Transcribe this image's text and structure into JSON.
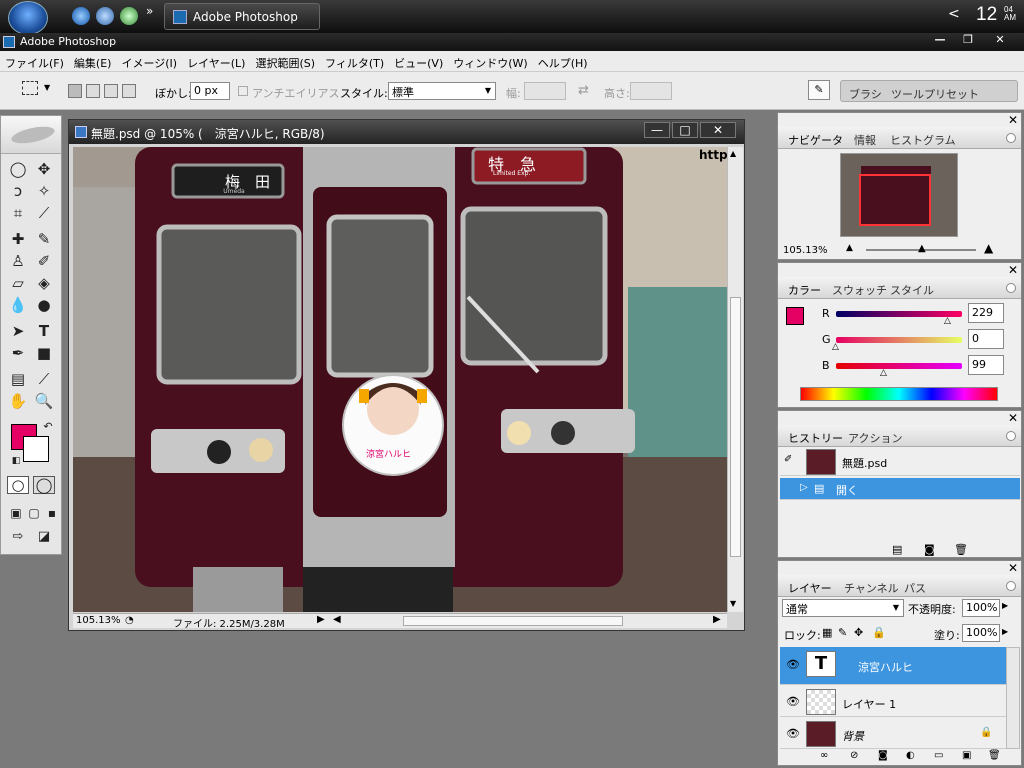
{
  "taskbar": {
    "app_button_label": "Adobe Photoshop",
    "clock_time": "12",
    "clock_min": "04",
    "clock_ampm": "AM",
    "tray_arrow": "<"
  },
  "app": {
    "title": "Adobe Photoshop"
  },
  "menu": [
    "ファイル(F)",
    "編集(E)",
    "イメージ(I)",
    "レイヤー(L)",
    "選択範囲(S)",
    "フィルタ(T)",
    "ビュー(V)",
    "ウィンドウ(W)",
    "ヘルプ(H)"
  ],
  "options": {
    "feather_label": "ぼかし:",
    "feather_value": "0 px",
    "antialias_label": "アンチエイリアス",
    "style_label": "スタイル:",
    "style_value": "標準",
    "width_label": "幅:",
    "height_label": "高さ:",
    "brush_tab": "ブラシ",
    "preset_tab": "ツールプリセット"
  },
  "document": {
    "title": "無題.psd @ 105% (　涼宮ハルヒ, RGB/8)",
    "zoom": "105.13%",
    "file_info": "ファイル: 2.25M/3.28M",
    "sign_left": "梅　田",
    "sign_left_sub": "Umeda",
    "sign_right": "特　急",
    "sign_right_sub": "Limited Exp.",
    "corner_text": "http",
    "badge_text": "涼宮ハルヒ"
  },
  "navigator": {
    "tabs": [
      "ナビゲータ",
      "情報",
      "ヒストグラム"
    ],
    "zoom": "105.13%"
  },
  "color": {
    "tabs": [
      "カラー",
      "スウォッチ",
      "スタイル"
    ],
    "r_label": "R",
    "r_value": "229",
    "g_label": "G",
    "g_value": "0",
    "b_label": "B",
    "b_value": "99",
    "foreground": "#e50063"
  },
  "history": {
    "tabs": [
      "ヒストリー",
      "アクション"
    ],
    "snapshot": "無題.psd",
    "step": "開く"
  },
  "layers": {
    "tabs": [
      "レイヤー",
      "チャンネル",
      "パス"
    ],
    "blend": "通常",
    "opacity_label": "不透明度:",
    "opacity": "100%",
    "lock_label": "ロック:",
    "fill_label": "塗り:",
    "fill": "100%",
    "items": [
      {
        "name": "涼宮ハルヒ",
        "type": "text"
      },
      {
        "name": "レイヤー 1",
        "type": "transparent"
      },
      {
        "name": "背景",
        "type": "image"
      }
    ]
  },
  "colors": {
    "selection": "#3d95e0",
    "accent": "#e50063"
  }
}
